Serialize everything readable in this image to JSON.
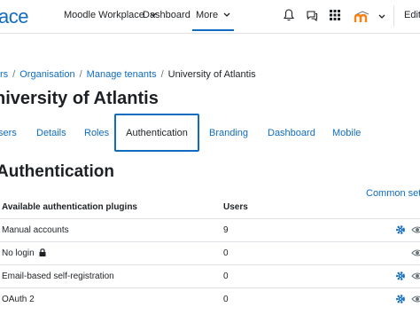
{
  "header": {
    "logo_text": "ace",
    "nav": {
      "workplace_label": "Moodle Workplace",
      "dashboard_label": "Dashboard",
      "more_label": "More"
    },
    "icons": [
      "bell-icon",
      "chat-icon",
      "apps-grid-icon",
      "moodle-user-logo",
      "chevron-down-icon"
    ],
    "edit_label": "Edit"
  },
  "breadcrumb": {
    "items": [
      {
        "label": "rs",
        "link": true
      },
      {
        "label": "Organisation",
        "link": true
      },
      {
        "label": "Manage tenants",
        "link": true
      },
      {
        "label": "University of Atlantis",
        "link": false
      }
    ],
    "separator": "/"
  },
  "page": {
    "title": "niversity of Atlantis"
  },
  "tabs": {
    "items": [
      "sers",
      "Details",
      "Roles",
      "Authentication",
      "Branding",
      "Dashboard",
      "Mobile"
    ],
    "active": "Authentication"
  },
  "auth": {
    "title": "Authentication",
    "common_settings_label": "Common setti",
    "columns": {
      "plugin": "Available authentication plugins",
      "users": "Users"
    },
    "rows": [
      {
        "name": "Manual accounts",
        "users": "9",
        "locked": false,
        "has_settings": true
      },
      {
        "name": "No login",
        "users": "0",
        "locked": true,
        "has_settings": false
      },
      {
        "name": "Email-based self-registration",
        "users": "0",
        "locked": false,
        "has_settings": true
      },
      {
        "name": "OAuth 2",
        "users": "0",
        "locked": false,
        "has_settings": true
      }
    ]
  },
  "colors": {
    "accent": "#0f6cbf",
    "text": "#1d2125",
    "border": "#dee2e6",
    "brand_orange": "#f98012"
  }
}
